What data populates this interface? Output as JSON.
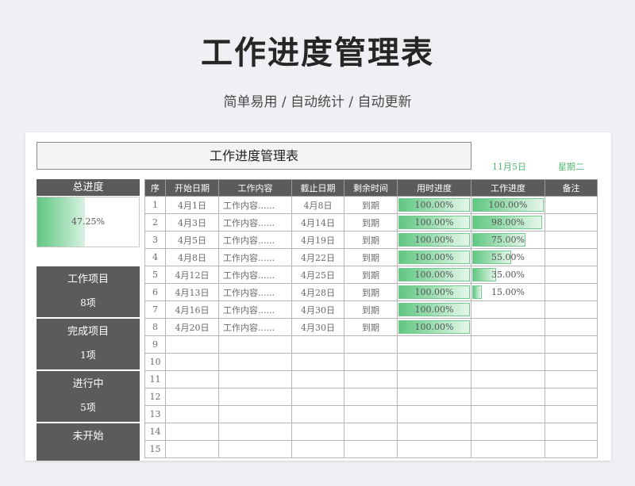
{
  "header": {
    "title": "工作进度管理表",
    "subtitle": "简单易用 / 自动统计 / 自动更新"
  },
  "sheet": {
    "title": "工作进度管理表",
    "date": "11月5日",
    "weekday": "星期二"
  },
  "summary": {
    "overall_label": "总进度",
    "overall_progress_text": "47.25%",
    "overall_progress": 0.4725,
    "stats": [
      {
        "label": "工作项目",
        "value": "8项"
      },
      {
        "label": "完成项目",
        "value": "1项"
      },
      {
        "label": "进行中",
        "value": "5项"
      },
      {
        "label": "未开始",
        "value": ""
      }
    ]
  },
  "table": {
    "columns": [
      "序",
      "开始日期",
      "工作内容",
      "截止日期",
      "剩余时间",
      "用时进度",
      "工作进度",
      "备注"
    ],
    "rows": [
      {
        "no": "1",
        "start": "4月1日",
        "task": "工作内容......",
        "end": "4月8日",
        "remain": "到期",
        "time_progress": 1.0,
        "time_text": "100.00%",
        "work_progress": 1.0,
        "work_text": "100.00%",
        "note": ""
      },
      {
        "no": "2",
        "start": "4月3日",
        "task": "工作内容......",
        "end": "4月14日",
        "remain": "到期",
        "time_progress": 1.0,
        "time_text": "100.00%",
        "work_progress": 0.98,
        "work_text": "98.00%",
        "note": ""
      },
      {
        "no": "3",
        "start": "4月5日",
        "task": "工作内容......",
        "end": "4月19日",
        "remain": "到期",
        "time_progress": 1.0,
        "time_text": "100.00%",
        "work_progress": 0.75,
        "work_text": "75.00%",
        "note": ""
      },
      {
        "no": "4",
        "start": "4月8日",
        "task": "工作内容......",
        "end": "4月22日",
        "remain": "到期",
        "time_progress": 1.0,
        "time_text": "100.00%",
        "work_progress": 0.55,
        "work_text": "55.00%",
        "note": ""
      },
      {
        "no": "5",
        "start": "4月12日",
        "task": "工作内容......",
        "end": "4月25日",
        "remain": "到期",
        "time_progress": 1.0,
        "time_text": "100.00%",
        "work_progress": 0.35,
        "work_text": "35.00%",
        "note": ""
      },
      {
        "no": "6",
        "start": "4月13日",
        "task": "工作内容......",
        "end": "4月28日",
        "remain": "到期",
        "time_progress": 1.0,
        "time_text": "100.00%",
        "work_progress": 0.15,
        "work_text": "15.00%",
        "note": ""
      },
      {
        "no": "7",
        "start": "4月16日",
        "task": "工作内容......",
        "end": "4月30日",
        "remain": "到期",
        "time_progress": 1.0,
        "time_text": "100.00%",
        "work_progress": 0,
        "work_text": "",
        "note": ""
      },
      {
        "no": "8",
        "start": "4月20日",
        "task": "工作内容......",
        "end": "4月30日",
        "remain": "到期",
        "time_progress": 1.0,
        "time_text": "100.00%",
        "work_progress": 0,
        "work_text": "",
        "note": ""
      },
      {
        "no": "9"
      },
      {
        "no": "10"
      },
      {
        "no": "11"
      },
      {
        "no": "12"
      },
      {
        "no": "13"
      },
      {
        "no": "14"
      },
      {
        "no": "15"
      }
    ]
  }
}
